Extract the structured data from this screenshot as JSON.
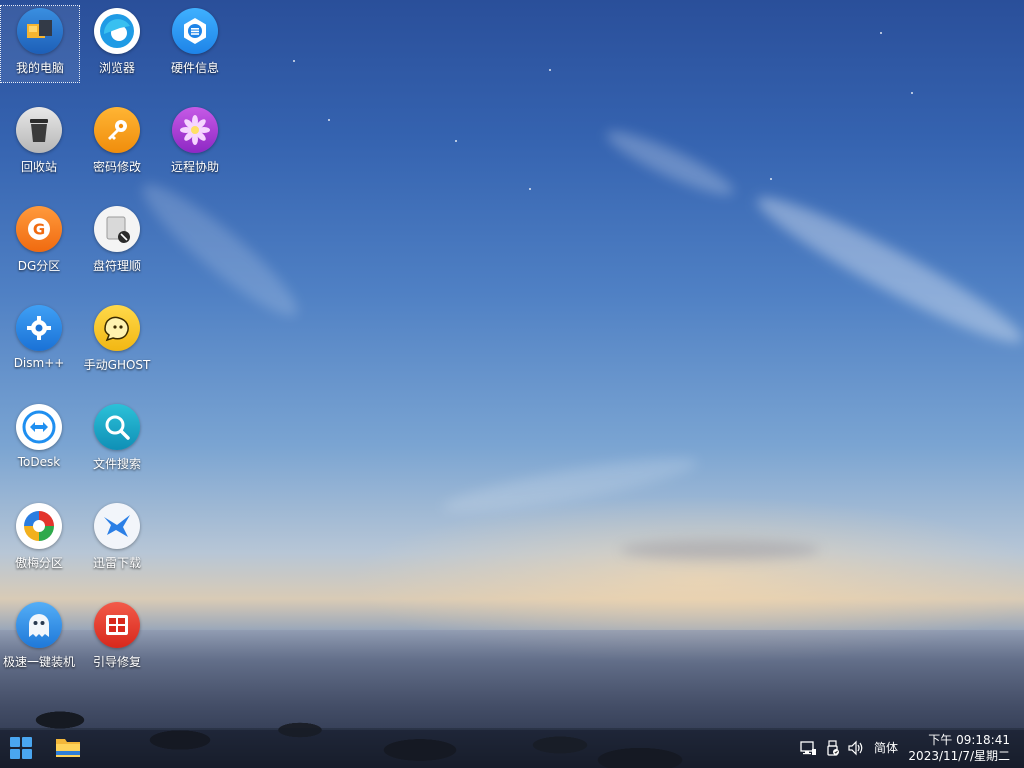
{
  "desktop": {
    "icons": [
      {
        "label": "我的电脑",
        "icon": "computer-icon"
      },
      {
        "label": "浏览器",
        "icon": "browser-icon"
      },
      {
        "label": "硬件信息",
        "icon": "hardware-info-icon"
      },
      {
        "label": "回收站",
        "icon": "recycle-bin-icon"
      },
      {
        "label": "密码修改",
        "icon": "key-icon"
      },
      {
        "label": "远程协助",
        "icon": "flower-icon"
      },
      {
        "label": "DG分区",
        "icon": "dg-partition-icon"
      },
      {
        "label": "盘符理顺",
        "icon": "drive-letter-icon"
      },
      {
        "label": "Dism++",
        "icon": "gear-icon"
      },
      {
        "label": "手动GHOST",
        "icon": "ghost-icon"
      },
      {
        "label": "ToDesk",
        "icon": "todesk-icon"
      },
      {
        "label": "文件搜索",
        "icon": "search-icon"
      },
      {
        "label": "傲梅分区",
        "icon": "aomei-partition-icon"
      },
      {
        "label": "迅雷下载",
        "icon": "thunder-bird-icon"
      },
      {
        "label": "极速一键装机",
        "icon": "installer-ghost-icon"
      },
      {
        "label": "引导修复",
        "icon": "boot-repair-icon"
      }
    ]
  },
  "taskbar": {
    "start_icon": "windows-start-icon",
    "pinned": [
      {
        "icon": "file-explorer-icon"
      }
    ],
    "tray": {
      "icons": [
        "network-icon",
        "usb-device-icon",
        "volume-icon"
      ],
      "ime_label": "简体",
      "time": "下午 09:18:41",
      "date": "2023/11/7/星期二"
    }
  },
  "colors": {
    "sky_top": "#2a4f9a",
    "sky_mid": "#7aa4d2",
    "sunset": "#d9cbb6",
    "start_blue": "#4aa6f0"
  }
}
